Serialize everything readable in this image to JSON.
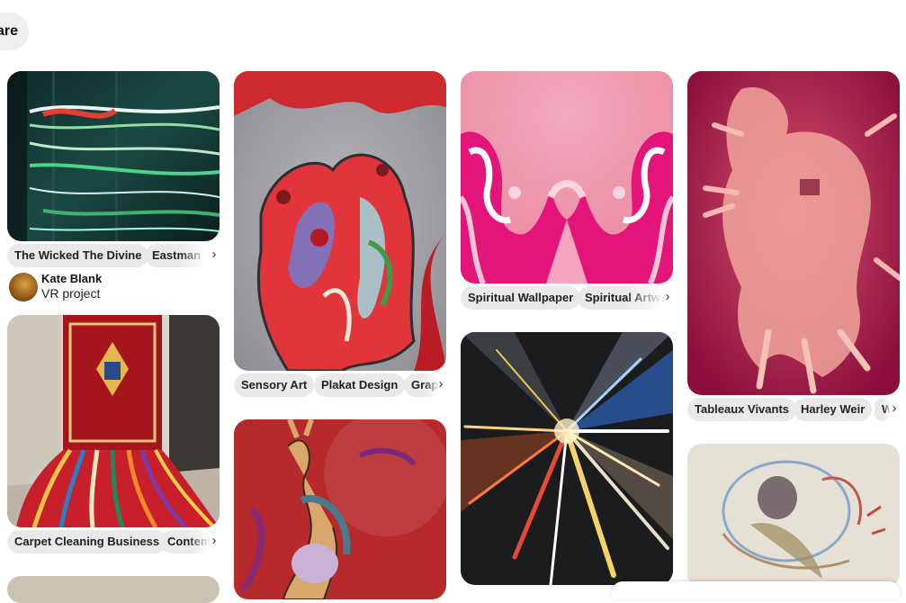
{
  "header": {
    "share_label": "are"
  },
  "pins": [
    {
      "id": "wicked",
      "tags": [
        "The Wicked The Divine",
        "Eastman"
      ],
      "author": {
        "name": "Kate Blank",
        "board": "VR project"
      }
    },
    {
      "id": "carpet",
      "tags": [
        "Carpet Cleaning Business",
        "Contem"
      ]
    },
    {
      "id": "sensory",
      "tags": [
        "Sensory Art",
        "Plakat Design",
        "Grap"
      ]
    },
    {
      "id": "figures",
      "tags": []
    },
    {
      "id": "spiritual",
      "tags": [
        "Spiritual Wallpaper",
        "Spiritual Artw"
      ]
    },
    {
      "id": "lights",
      "tags": []
    },
    {
      "id": "tableaux",
      "tags": [
        "Tableaux Vivants",
        "Harley Weir",
        "W"
      ]
    },
    {
      "id": "sketch",
      "tags": []
    }
  ],
  "icons": {
    "chevron": "chevron-right-icon"
  },
  "colors": {
    "tag_bg": "#e9e9e9",
    "button_bg": "#efefef"
  }
}
